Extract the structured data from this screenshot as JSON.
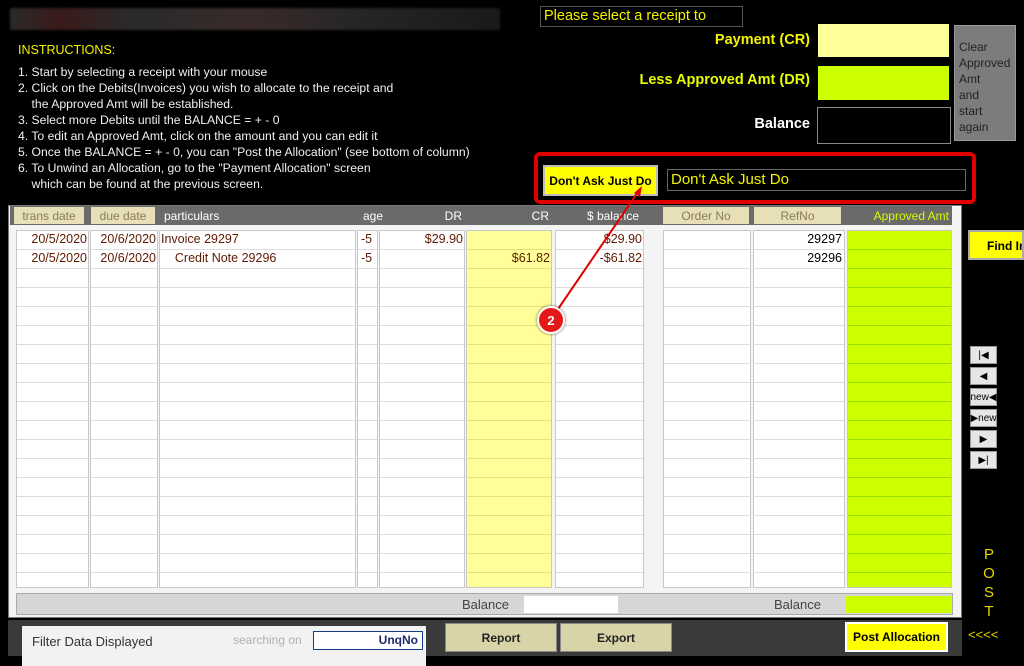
{
  "instructions": {
    "title": "INSTRUCTIONS:",
    "lines": [
      "1. Start by selecting a receipt with your mouse",
      "2. Click on the Debits(Invoices) you wish to allocate to the receipt and",
      "    the Approved Amt will be established.",
      "3. Select more Debits until the BALANCE = + - 0",
      "4. To edit an Approved Amt, click on the amount and you can edit it",
      "5. Once the BALANCE = + - 0, you can \"Post the Allocation\" (see bottom of column)",
      "6. To Unwind an Allocation, go to the \"Payment Allocation\" screen",
      "    which can be found at the previous screen."
    ]
  },
  "receipt_prompt": "Please select a receipt to",
  "totals": {
    "payment_label": "Payment (CR)",
    "less_label": "Less Approved Amt (DR)",
    "balance_label": "Balance"
  },
  "clear_button": [
    "Clear",
    "Approved",
    "Amt",
    "and",
    "start",
    "again"
  ],
  "dont_ask": {
    "button": "Don't Ask Just Do",
    "field": "Don't Ask Just Do"
  },
  "columns": {
    "trans_date": "trans date",
    "due_date": "due date",
    "particulars": "particulars",
    "age": "age",
    "dr": "DR",
    "cr": "CR",
    "balance": "$ balance",
    "order_no": "Order No",
    "ref_no": "RefNo",
    "approved": "Approved Amt"
  },
  "rows": [
    {
      "trans_date": "20/5/2020",
      "due_date": "20/6/2020",
      "particulars": "Invoice 29297",
      "age": "-5",
      "dr": "$29.90",
      "cr": "",
      "balance": "$29.90",
      "order_no": "",
      "ref_no": "29297",
      "approved": ""
    },
    {
      "trans_date": "20/5/2020",
      "due_date": "20/6/2020",
      "particulars": "    Credit Note 29296",
      "age": "-5",
      "dr": "",
      "cr": "$61.82",
      "balance": "-$61.82",
      "order_no": "",
      "ref_no": "29296",
      "approved": ""
    }
  ],
  "footer": {
    "balance_label_1": "Balance",
    "balance_label_2": "Balance"
  },
  "bottom": {
    "filter_label": "Filter Data Displayed",
    "searching_on": "searching on",
    "search_field": "UnqNo",
    "report": "Report",
    "export": "Export",
    "post_allocation": "Post Allocation"
  },
  "side": {
    "find": "Find Im",
    "nav": [
      "|◀",
      "◀",
      "new◀",
      "▶new",
      "▶",
      "▶|"
    ],
    "post_letters": [
      "P",
      "O",
      "S",
      "T"
    ],
    "post_arrows": "<<<<"
  },
  "annotation": {
    "badge": "2"
  },
  "colors": {
    "yellow": "#ffff00",
    "pale_yellow": "#ffff99",
    "lime": "#ccff00",
    "annotation_red": "#e00000"
  }
}
